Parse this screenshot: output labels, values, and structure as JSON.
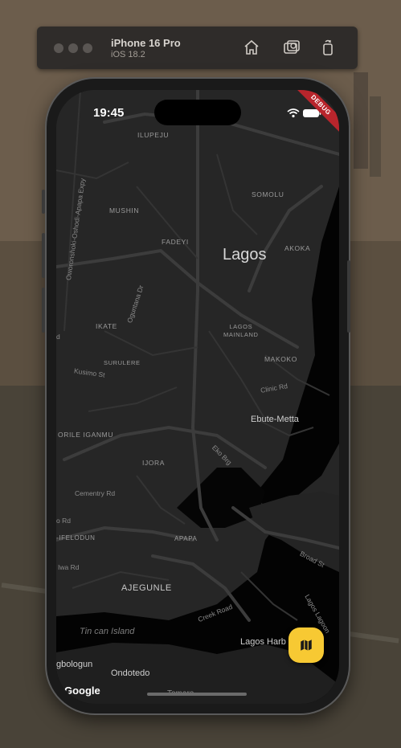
{
  "simulator": {
    "device_name": "iPhone 16 Pro",
    "os_version": "iOS 18.2",
    "icons": [
      "home-icon",
      "screenshot-icon",
      "rotate-icon"
    ]
  },
  "status_bar": {
    "time": "19:45",
    "icons": [
      "wifi-icon",
      "battery-icon"
    ]
  },
  "debug_banner": "DEBUG",
  "map": {
    "provider_logo": "Google",
    "city_label": "Lagos",
    "areas": {
      "ilupeju": "ILUPEJU",
      "somolu": "SOMOLU",
      "mushin": "MUSHIN",
      "fadeyi": "FADEYI",
      "akoka": "AKOKA",
      "ikate": "IKATE",
      "lagos_mainland": "LAGOS\nMAINLAND",
      "makoko": "MAKOKO",
      "surulere": "SURULERE",
      "orile_iganmu": "ORILE IGANMU",
      "ijora": "IJORA",
      "ifelodun": "-IFELODUN",
      "apapa": "APAPA",
      "ajegunle": "AJEGUNLE"
    },
    "places": {
      "ebute_metta": "Ebute-Metta",
      "lagos_harbour": "Lagos Harb",
      "ogbologun": "gbologun",
      "ondotedo": "Ondotedo",
      "tomaro": "Tomaro"
    },
    "roads": {
      "oworonshoki": "Oworonshoki-Oshodi-Apapa Expy",
      "oguntana": "Oguntana Dr",
      "kusimo": "Kusimo St",
      "clinic": "Clinic Rd",
      "eko_brg": "Eko Brg",
      "cementry": "Cementry Rd",
      "o_rd": "o Rd",
      "iwa": "Iwa Rd",
      "broad": "Broad St",
      "creek": "Creek Road",
      "lagos_lagoon": "Lagos Lagoon",
      "rd_left": "d"
    },
    "water": {
      "tin_can": "Tin can Island"
    }
  },
  "fab": {
    "icon": "map-icon"
  },
  "colors": {
    "fab": "#f7c933",
    "water": "#000000",
    "land": "#242424",
    "roads": "#3d3d3d",
    "debug": "#b8252c"
  }
}
